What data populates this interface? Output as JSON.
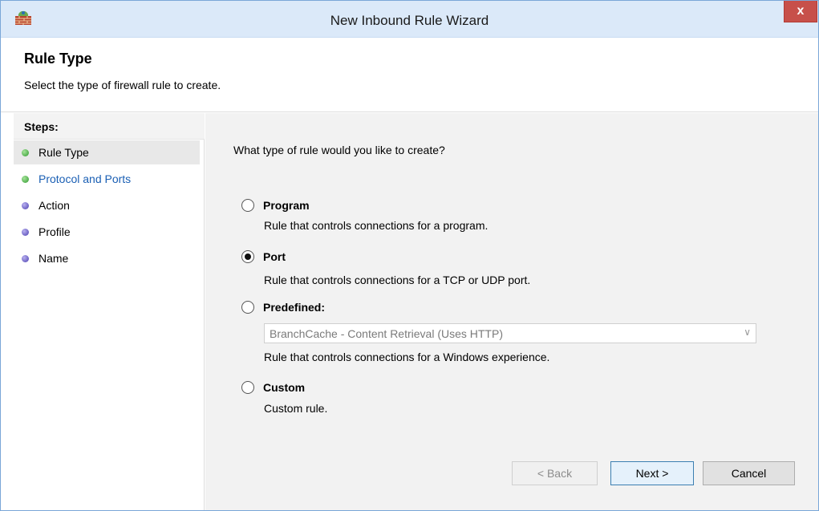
{
  "window": {
    "title": "New Inbound Rule Wizard",
    "close_glyph": "x"
  },
  "header": {
    "title": "Rule Type",
    "subtitle": "Select the type of firewall rule to create."
  },
  "steps": {
    "heading": "Steps:",
    "items": [
      {
        "label": "Rule Type",
        "state": "current"
      },
      {
        "label": "Protocol and Ports",
        "state": "link"
      },
      {
        "label": "Action",
        "state": "pending"
      },
      {
        "label": "Profile",
        "state": "pending"
      },
      {
        "label": "Name",
        "state": "pending"
      }
    ]
  },
  "main": {
    "question": "What type of rule would you like to create?",
    "options": [
      {
        "label": "Program",
        "description": "Rule that controls connections for a program.",
        "selected": false
      },
      {
        "label": "Port",
        "description": "Rule that controls connections for a TCP or UDP port.",
        "selected": true
      },
      {
        "label": "Predefined:",
        "description": "Rule that controls connections for a Windows experience.",
        "selected": false
      },
      {
        "label": "Custom",
        "description": "Custom rule.",
        "selected": false
      }
    ],
    "predefined_select": {
      "value": "BranchCache - Content Retrieval (Uses HTTP)",
      "enabled": false
    }
  },
  "buttons": {
    "back": "< Back",
    "next": "Next >",
    "cancel": "Cancel"
  },
  "colors": {
    "step_done": "#2f9a2f",
    "step_pending": "#4b3fb0",
    "link": "#1a5fb4",
    "close": "#c7504a"
  }
}
